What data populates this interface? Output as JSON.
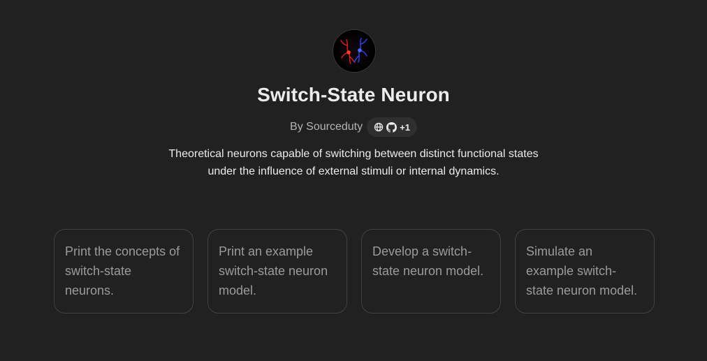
{
  "gpt": {
    "title": "Switch-State Neuron",
    "author_line": "By Sourceduty",
    "extra_links_count": "+1",
    "description": "Theoretical neurons capable of switching between distinct functional states under the influence of external stimuli or internal dynamics."
  },
  "icons": {
    "avatar": "neuron-avatar-image",
    "website": "globe-icon",
    "repo": "github-icon"
  },
  "colors": {
    "background": "#212121",
    "card_border": "#424242",
    "pill_bg": "#2f2f2f",
    "title_text": "#ececec",
    "muted_text": "#b4b4b4",
    "card_text": "#9b9b9b"
  },
  "starters": [
    {
      "label": "Print the concepts of switch-state neurons."
    },
    {
      "label": "Print an example switch-state neuron model."
    },
    {
      "label": "Develop a switch-state neuron model."
    },
    {
      "label": "Simulate an example switch-state neuron model."
    }
  ]
}
